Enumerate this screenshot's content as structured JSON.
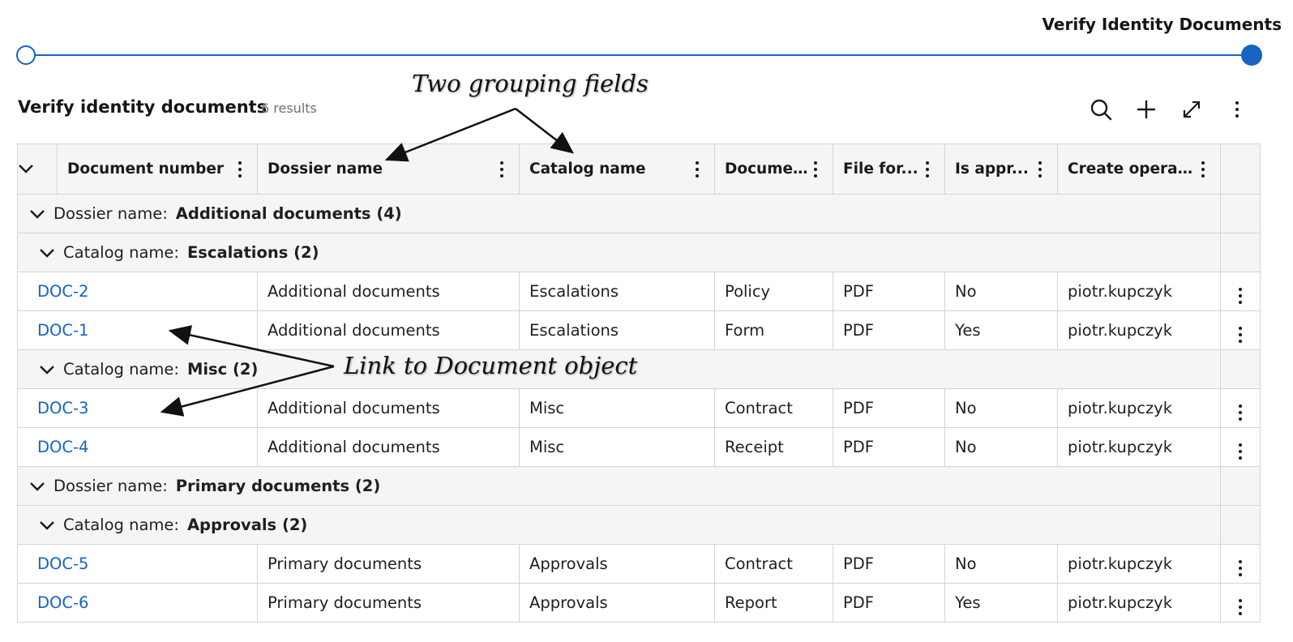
{
  "step": {
    "title": "Verify Identity Documents"
  },
  "grid": {
    "title": "Verify identity documents",
    "count": "6 results",
    "toolbar": [
      "search-icon",
      "plus-icon",
      "expand-icon",
      "more-vertical-icon"
    ],
    "columns": [
      {
        "label": "Document number"
      },
      {
        "label": "Dossier name"
      },
      {
        "label": "Catalog name"
      },
      {
        "label": "Docume..."
      },
      {
        "label": "File for..."
      },
      {
        "label": "Is appr..."
      },
      {
        "label": "Create operat..."
      }
    ],
    "groups": [
      {
        "label": "Dossier name:",
        "value": "Additional documents (4)",
        "subgroups": [
          {
            "label": "Catalog name:",
            "value": "Escalations (2)",
            "rows": [
              [
                "DOC-2",
                "Additional documents",
                "Escalations",
                "Policy",
                "PDF",
                "No",
                "piotr.kupczyk"
              ],
              [
                "DOC-1",
                "Additional documents",
                "Escalations",
                "Form",
                "PDF",
                "Yes",
                "piotr.kupczyk"
              ]
            ]
          },
          {
            "label": "Catalog name:",
            "value": "Misc (2)",
            "rows": [
              [
                "DOC-3",
                "Additional documents",
                "Misc",
                "Contract",
                "PDF",
                "No",
                "piotr.kupczyk"
              ],
              [
                "DOC-4",
                "Additional documents",
                "Misc",
                "Receipt",
                "PDF",
                "No",
                "piotr.kupczyk"
              ]
            ]
          }
        ]
      },
      {
        "label": "Dossier name:",
        "value": "Primary documents (2)",
        "subgroups": [
          {
            "label": "Catalog name:",
            "value": "Approvals (2)",
            "rows": [
              [
                "DOC-5",
                "Primary documents",
                "Approvals",
                "Contract",
                "PDF",
                "No",
                "piotr.kupczyk"
              ],
              [
                "DOC-6",
                "Primary documents",
                "Approvals",
                "Report",
                "PDF",
                "Yes",
                "piotr.kupczyk"
              ]
            ]
          }
        ]
      }
    ]
  },
  "annotations": {
    "grouping": "Two grouping fields",
    "link": "Link to Document object"
  },
  "colors": {
    "accent": "#1565c0",
    "header_bg": "#f5f5f5",
    "border": "#d4d4d4"
  }
}
